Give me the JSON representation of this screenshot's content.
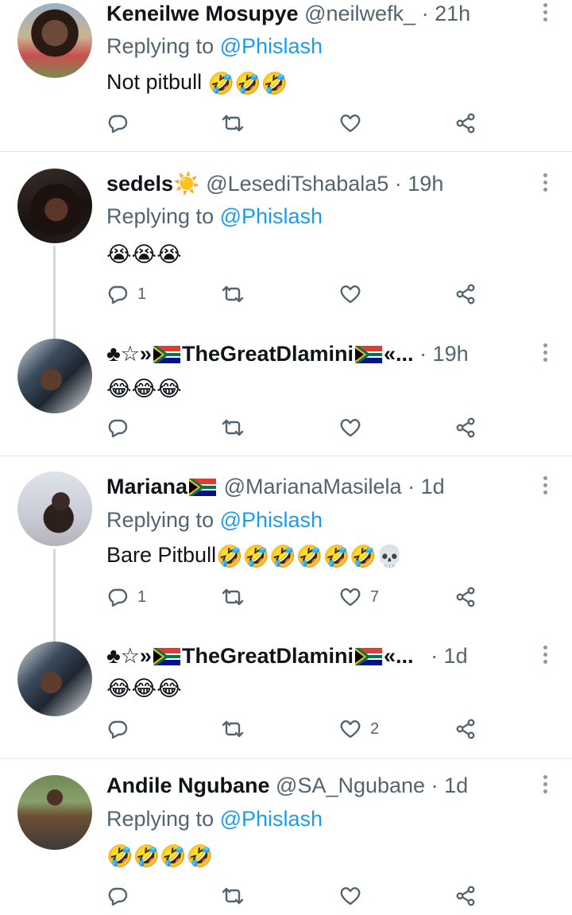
{
  "colors": {
    "text": "#0f1419",
    "secondary": "#536471",
    "accent": "#1d9bf0",
    "divider": "#e3e6e8",
    "thread_line": "#cfd9de"
  },
  "tweets": [
    {
      "name": "Keneilwe Mosupye",
      "handle": "@neilwefk_",
      "time": "· 21h",
      "reply_label": "Replying to",
      "reply_to": "@Phislash",
      "text": "Not pitbull",
      "emojis": "🤣🤣🤣",
      "reply_count": "",
      "like_count": ""
    },
    {
      "name": "sedels",
      "name_emoji": "☀️",
      "handle": "@LesediTshabala5",
      "time": "· 19h",
      "reply_label": "Replying to",
      "reply_to": "@Phislash",
      "text": "",
      "emojis": "😭😭😭",
      "reply_count": "1",
      "like_count": ""
    },
    {
      "name_prefix": "♣☆»",
      "name": "TheGreatDlamini",
      "name_suffix": "«...",
      "handle": "",
      "time": "· 19h",
      "text": "",
      "emojis": "😂😂😂",
      "reply_count": "",
      "like_count": ""
    },
    {
      "name": "Mariana",
      "handle": "@MarianaMasilela",
      "time": "· 1d",
      "reply_label": "Replying to",
      "reply_to": "@Phislash",
      "text": "Bare Pitbull",
      "emojis": "🤣🤣🤣🤣🤣🤣💀",
      "reply_count": "1",
      "like_count": "7"
    },
    {
      "name_prefix": "♣☆»",
      "name": "TheGreatDlamini",
      "name_suffix": "«...",
      "handle": "",
      "time": "· 1d",
      "text": "",
      "emojis": "😂😂😂",
      "reply_count": "",
      "like_count": "2"
    },
    {
      "name": "Andile Ngubane",
      "handle": "@SA_Ngubane",
      "time": "· 1d",
      "reply_label": "Replying to",
      "reply_to": "@Phislash",
      "text": "",
      "emojis": "🤣🤣🤣🤣",
      "reply_count": "",
      "like_count": ""
    }
  ]
}
